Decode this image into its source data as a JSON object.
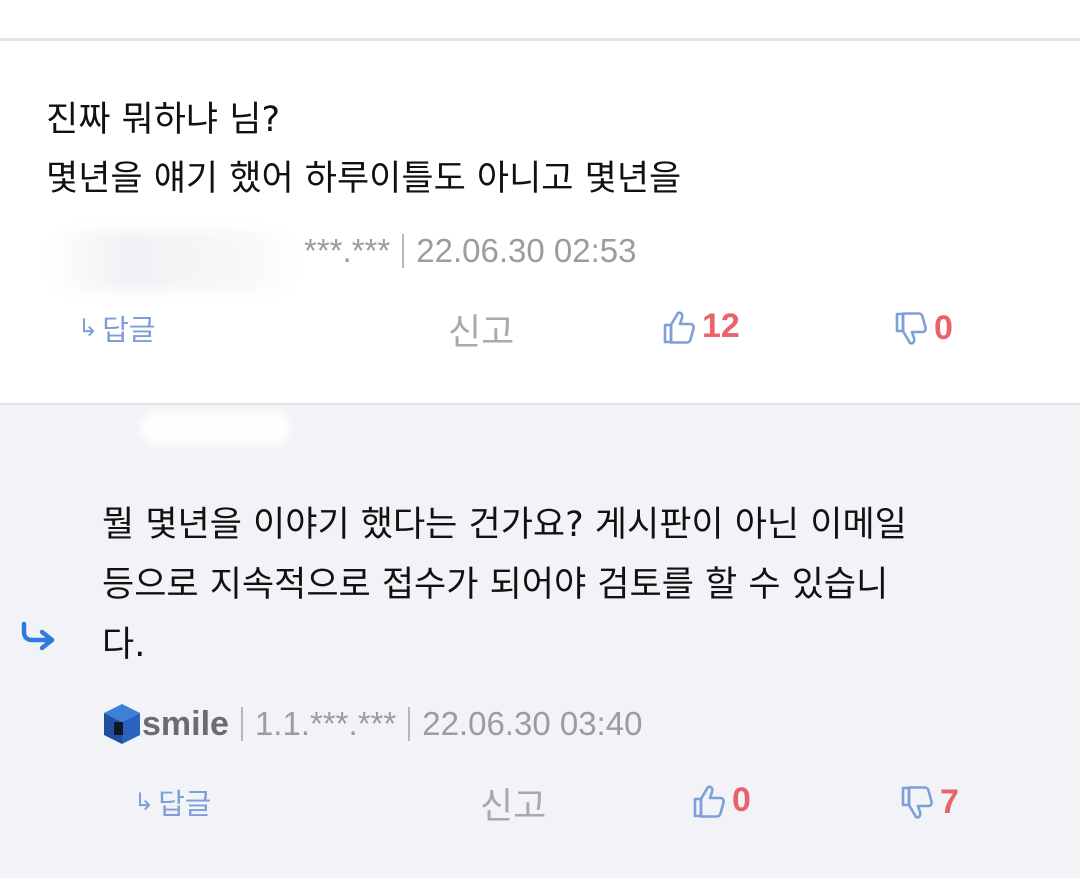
{
  "comments": [
    {
      "lines": [
        "진짜 뭐하냐 님?",
        "몇년을 얘기 했어 하루이틀도 아니고 몇년을"
      ],
      "ip": "***.***",
      "timestamp": "22.06.30 02:53",
      "reply_label": "답글",
      "report_label": "신고",
      "likes": "12",
      "dislikes": "0"
    },
    {
      "lines": [
        "뭘 몇년을 이야기 했다는 건가요? 게시판이 아닌 이메일",
        "등으로 지속적으로 접수가 되어야 검토를 할 수 있습니",
        "다."
      ],
      "author": "smile",
      "ip": "1.1.***.***",
      "timestamp": "22.06.30 03:40",
      "reply_label": "답글",
      "report_label": "신고",
      "likes": "0",
      "dislikes": "7"
    }
  ],
  "icons": {
    "reply_arrow": "reply-arrow-icon",
    "like": "thumbs-up-icon",
    "dislike": "thumbs-down-icon",
    "avatar": "cube-avatar-icon"
  },
  "colors": {
    "link_blue": "#7d9ed6",
    "vote_red": "#e8636b",
    "reply_indicator_blue": "#2f7be0",
    "meta_gray": "#9b9ca1"
  }
}
